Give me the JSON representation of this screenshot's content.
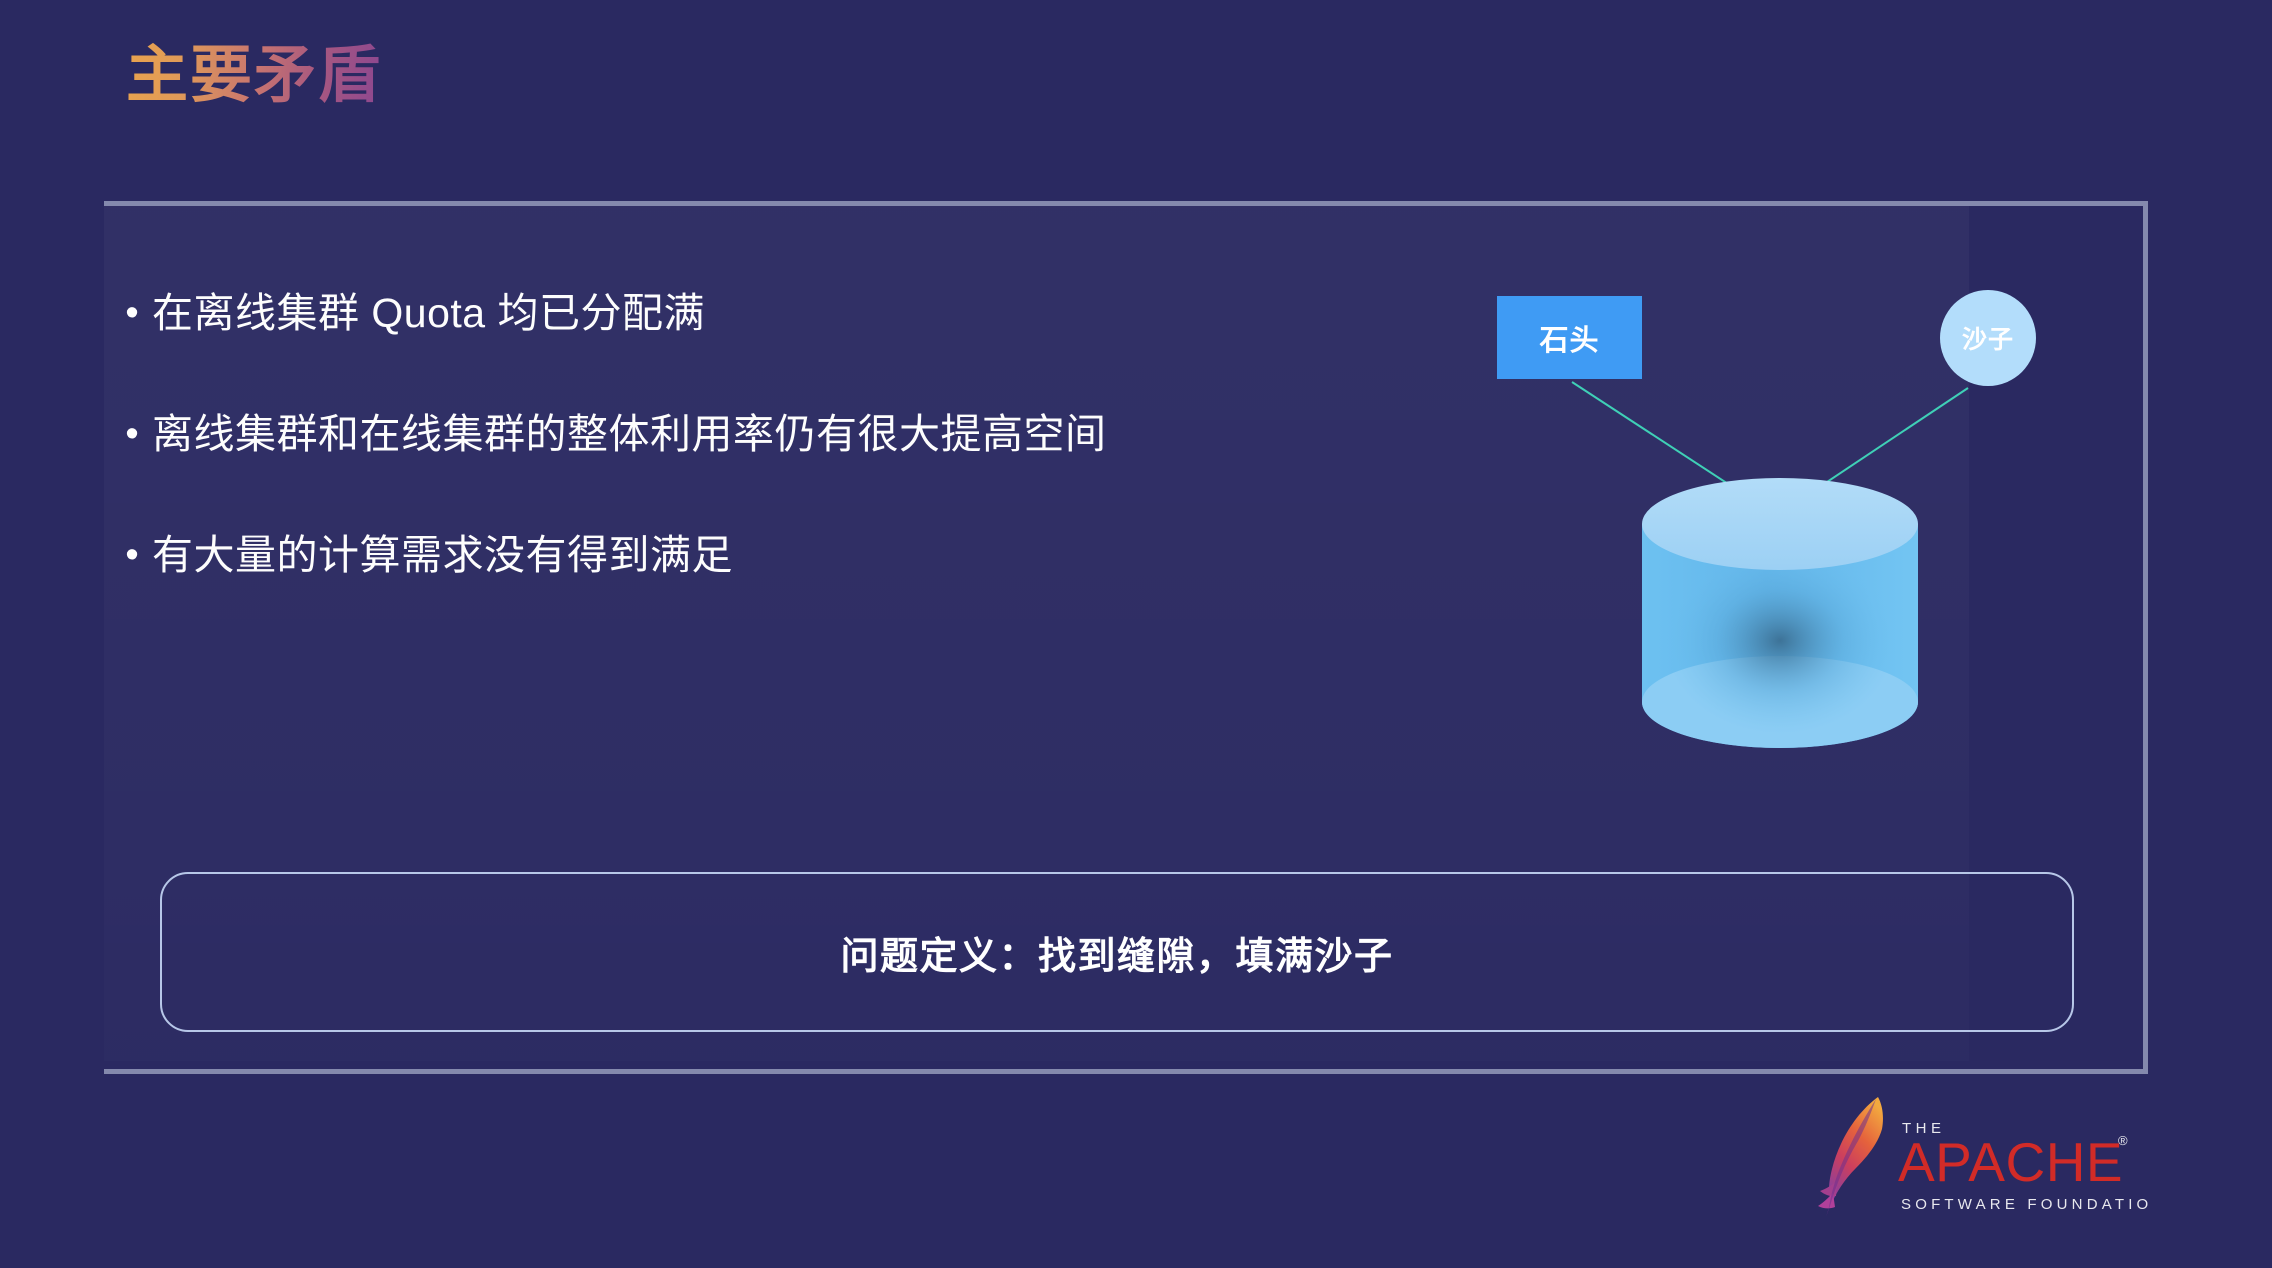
{
  "slide": {
    "title": "主要矛盾",
    "background_color": "#2a2961",
    "title_gradient_from": "#e9a34e",
    "title_gradient_to": "#8c4790"
  },
  "bullets": [
    {
      "marker": "•",
      "text": "在离线集群 Quota 均已分配满"
    },
    {
      "marker": "•",
      "text": "离线集群和在线集群的整体利用率仍有很大提高空间"
    },
    {
      "marker": "•",
      "text": "有大量的计算需求没有得到满足"
    }
  ],
  "diagram": {
    "stone": {
      "label": "石头",
      "color": "#3f9bf4"
    },
    "sand": {
      "label": "沙子",
      "color": "#b3ddfb"
    },
    "cylinder": {
      "color": "#6cc0f0",
      "top_color": "#a9d8f7"
    },
    "arrow_color": "#3fd0b6"
  },
  "callout": {
    "text": "问题定义：找到缝隙，填满沙子",
    "border_color": "#b7c7e8"
  },
  "footer_logo": {
    "the": "THE",
    "apache": "APACHE",
    "registered": "®",
    "foundation": "SOFTWARE FOUNDATION",
    "wordmark_color": "#d22b27"
  }
}
